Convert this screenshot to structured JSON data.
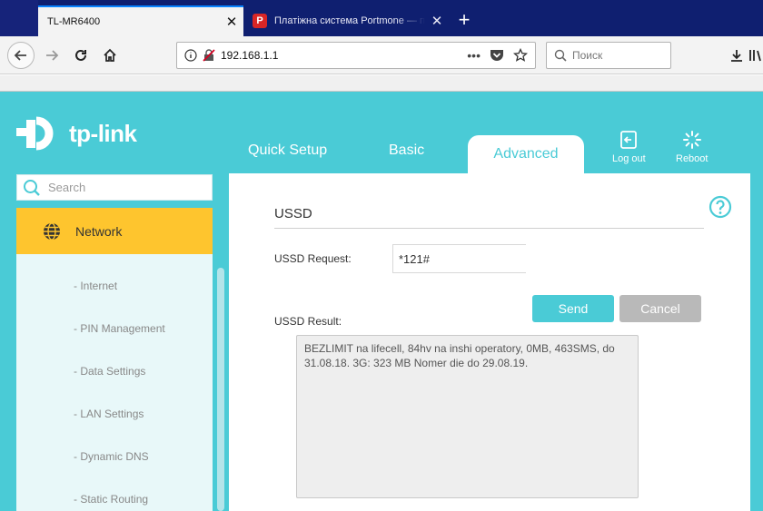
{
  "browser": {
    "tabs": [
      {
        "title": "TL-MR6400",
        "active": true,
        "close": "✕"
      },
      {
        "title": "Платіжна система Portmone — по",
        "active": false,
        "favicon": "P",
        "close": "✕"
      }
    ],
    "new_tab": "+",
    "url": "192.168.1.1",
    "search_placeholder": "Поиск",
    "page_actions": "•••"
  },
  "router": {
    "brand": "tp-link",
    "nav_tabs": {
      "quick_setup": "Quick Setup",
      "basic": "Basic",
      "advanced": "Advanced"
    },
    "actions": {
      "logout": "Log out",
      "reboot": "Reboot"
    },
    "sidebar": {
      "search_placeholder": "Search",
      "active_section": "Network",
      "items": [
        "- Internet",
        "- PIN Management",
        "- Data Settings",
        "- LAN Settings",
        "- Dynamic DNS",
        "- Static Routing"
      ]
    },
    "ussd": {
      "title": "USSD",
      "request_label": "USSD Request:",
      "request_value": "*121#",
      "send_label": "Send",
      "cancel_label": "Cancel",
      "result_label": "USSD Result:",
      "result_text": "BEZLIMIT na lifecell, 84hv na inshi operatory, 0MB, 463SMS, do 31.08.18. 3G: 323 MB Nomer die do 29.08.19."
    },
    "colors": {
      "accent": "#4acbd6",
      "active_menu": "#fec52e",
      "cancel": "#b9b9b9"
    }
  }
}
